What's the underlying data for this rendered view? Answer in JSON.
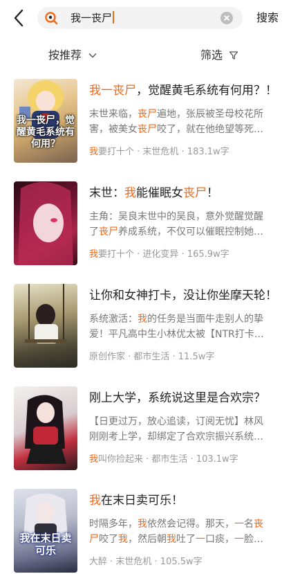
{
  "search": {
    "query": "我一丧尸",
    "button": "搜索"
  },
  "filters": {
    "sort_label": "按推荐",
    "filter_label": "筛选"
  },
  "results": [
    {
      "title": [
        "我一丧尸",
        "，觉醒黄毛系统有何用？！"
      ],
      "desc1": [
        "末世来临，",
        "丧尸",
        "遍地，张辰被圣母校花所"
      ],
      "desc2": [
        "害，被美女",
        "丧尸",
        "咬了，就在他绝望等死…"
      ],
      "meta": [
        "我",
        "要打十个 · 末世危机 · 183.1w字"
      ],
      "cover_text": "我一丧尸，觉醒黄毛系统有何用？"
    },
    {
      "title": [
        "末世：",
        "我",
        "能催眠女",
        "丧尸",
        "！"
      ],
      "desc1": [
        "主角：吴良末世中的吴良，意外觉醒觉醒"
      ],
      "desc2": [
        "了",
        "丧尸",
        "养成系统，不仅可以催眠控制她…"
      ],
      "meta": [
        "我",
        "要打十个 · 进化变异 · 165.9w字"
      ]
    },
    {
      "title": [
        "让你和女神打卡，没让你坐摩天轮！"
      ],
      "desc1": [
        "系统激活：",
        "我",
        "的任务是当面牛走别人的挚"
      ],
      "desc2": [
        "爱！平凡高中生小林优太被【NTR打卡…"
      ],
      "meta": [
        "原创作家 · 都市生活 · 11.5w字"
      ]
    },
    {
      "title": [
        "刚上大学，系统说这里是合欢宗？"
      ],
      "desc1": [
        "【日更过万，放心追读，订阅无忧】林风"
      ],
      "desc2": [
        "刚刚考上学，却绑定了合欢宗振兴系统…"
      ],
      "meta": [
        "我",
        "叫你捡起来 · 都市生活 · 103.1w字"
      ]
    },
    {
      "title": [
        "我",
        "在末日卖可乐！"
      ],
      "desc1": [
        "时隔多年，",
        "我",
        "依然会记得。那天，",
        "一",
        "名",
        "丧"
      ],
      "desc2": [
        "尸",
        "咬了",
        "我",
        "，然后朝",
        "我",
        "吐了",
        "一",
        "口痰，",
        "一",
        "脸…"
      ],
      "meta": [
        "大醉 · 末世危机 · 105.5w字"
      ],
      "cover_text": "我在末日卖可乐"
    }
  ]
}
